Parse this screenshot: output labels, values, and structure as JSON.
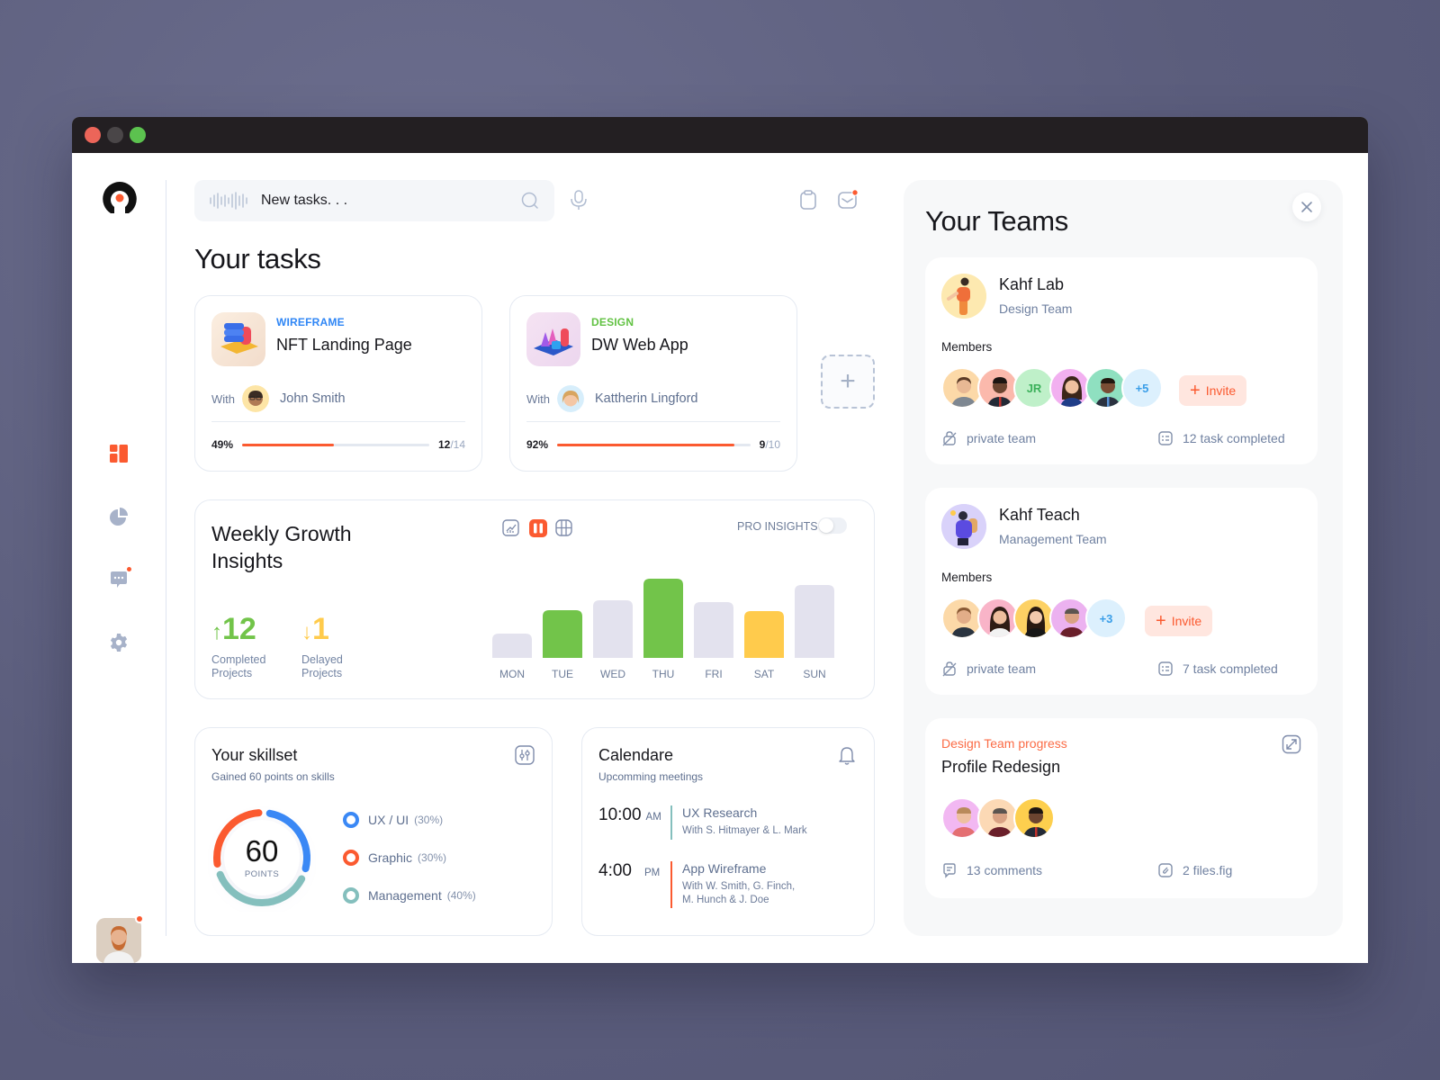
{
  "window": {
    "controls": [
      "close",
      "minimize",
      "maximize"
    ]
  },
  "sidebar": {
    "logo": "app-logo",
    "items": [
      {
        "name": "dashboard",
        "icon": "dashboard-icon",
        "active": true
      },
      {
        "name": "analytics",
        "icon": "pie-chart-icon",
        "active": false
      },
      {
        "name": "messages",
        "icon": "chat-icon",
        "active": false,
        "badge": true
      },
      {
        "name": "settings",
        "icon": "gear-icon",
        "active": false
      }
    ],
    "user": {
      "has_notification": true
    }
  },
  "header": {
    "search": {
      "value": "New tasks. . .",
      "placeholder": "New tasks. . ."
    },
    "icons": [
      "mic-icon",
      "clipboard-icon",
      "inbox-icon"
    ]
  },
  "tasks": {
    "title": "Your tasks",
    "items": [
      {
        "category": "WIREFRAME",
        "category_color": "#2f86f5",
        "name": "NFT Landing Page",
        "with_label": "With",
        "person": "John Smith",
        "progress_pct": 49,
        "progress_label": "49%",
        "done": "12",
        "total": "/14"
      },
      {
        "category": "DESIGN",
        "category_color": "#62c243",
        "name": "DW Web App",
        "with_label": "With",
        "person": "Kattherin Lingford",
        "progress_pct": 92,
        "progress_label": "92%",
        "done": "9",
        "total": "/10"
      }
    ],
    "add_label": "+"
  },
  "growth": {
    "title": "Weekly Growth Insights",
    "completed": {
      "value": "12",
      "arrow": "↑",
      "label": "Completed Projects"
    },
    "delayed": {
      "value": "1",
      "arrow": "↓",
      "label": "Delayed Projects"
    },
    "pro_label": "PRO INSIGHTS",
    "pro_enabled": false,
    "view_modes": [
      "line-chart-icon",
      "bar-chart-icon",
      "grid-icon"
    ],
    "active_view": "bar-chart-icon"
  },
  "chart_data": {
    "type": "bar",
    "title": "Weekly Growth Insights",
    "categories": [
      "MON",
      "TUE",
      "WED",
      "THU",
      "FRI",
      "SAT",
      "SUN"
    ],
    "values": [
      27,
      53,
      64,
      88,
      62,
      52,
      81
    ],
    "colors": [
      "#e3e2ee",
      "#72c44a",
      "#e3e2ee",
      "#72c44a",
      "#e3e2ee",
      "#ffcb4c",
      "#e3e2ee"
    ],
    "ylim": [
      0,
      100
    ],
    "xlabel": "",
    "ylabel": "",
    "grid": false
  },
  "skills": {
    "title": "Your skillset",
    "subtitle": "Gained 60 points on skills",
    "points": "60",
    "points_label": "POINTS",
    "items": [
      {
        "name": "UX / UI",
        "pct_label": "(30%)",
        "pct": 30,
        "color": "#3a88f5"
      },
      {
        "name": "Graphic",
        "pct_label": "(30%)",
        "pct": 30,
        "color": "#fb5a30"
      },
      {
        "name": "Management",
        "pct_label": "(40%)",
        "pct": 40,
        "color": "#84bfbd"
      }
    ]
  },
  "calendar": {
    "title": "Calendare",
    "subtitle": "Upcomming meetings",
    "meetings": [
      {
        "time": "10:00",
        "ampm": "AM",
        "title": "UX  Research",
        "with": "With S. Hitmayer & L. Mark",
        "color": "#84bfbd"
      },
      {
        "time": "4:00",
        "ampm": "PM",
        "title": "App Wireframe",
        "with": "With W. Smith, G. Finch, M. Hunch & J. Doe",
        "color": "#fb5a30"
      }
    ]
  },
  "teams": {
    "title": "Your Teams",
    "list": [
      {
        "name": "Kahf Lab",
        "type": "Design Team",
        "members_label": "Members",
        "initials": "JR",
        "extra": "+5",
        "invite": "Invite",
        "privacy": "private team",
        "tasks": "12 task completed"
      },
      {
        "name": "Kahf Teach",
        "type": "Management Team",
        "members_label": "Members",
        "extra": "+3",
        "invite": "Invite",
        "privacy": "private team",
        "tasks": "7 task completed"
      }
    ],
    "progress": {
      "label": "Design Team progress",
      "title": "Profile Redesign",
      "comments": "13 comments",
      "files": "2 files.fig"
    }
  }
}
